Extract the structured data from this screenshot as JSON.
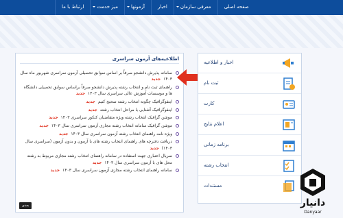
{
  "nav": {
    "items": [
      {
        "label": "صفحه اصلی",
        "dropdown": false
      },
      {
        "label": "معرفی سازمان",
        "dropdown": true
      },
      {
        "label": "اخبار",
        "dropdown": false
      },
      {
        "label": "آزمونها",
        "dropdown": true
      },
      {
        "label": "میز خدمت",
        "dropdown": true
      },
      {
        "label": "ارتباط با ما",
        "dropdown": false
      }
    ]
  },
  "news": {
    "title": "اطلاعیه‌های آزمون سراسری",
    "new_badge": "جدید",
    "more_label": "بعدی",
    "items": [
      {
        "text": "سامانه پذیرش دانشجو صرفاً بر اساس سوابق تحصیلی آزمون سراسری شهریور ماه سال ۱۴۰۳",
        "new": true
      },
      {
        "text": "راهنمای ثبت نام و انتخاب رشته پذیرش دانشجو صرفاً براساس سوابق تحصیلی دانشگاه ها و موسسات آموزش عالی سراسری سال ۱۴۰۳",
        "new": true
      },
      {
        "text": "اینفوگرافیک چگونه انتخاب رشته صحیح کنیم",
        "new": true
      },
      {
        "text": "اینفوگرافیک آشنایی با مراحل انتخاب رشته",
        "new": true
      },
      {
        "text": "موشن گرافیک انتخاب رشته ویژه متقاضیان کنکور سراسری ۱۴۰۳",
        "new": true
      },
      {
        "text": "موشن گرافیک سامانه انتخاب رشته مجازی آزمون سراسری سال ۱۴۰۳",
        "new": true
      },
      {
        "text": "ویژه نامه راهنمای انتخاب رشته آزمون سراسری سال ۱۴۰۳",
        "new": true
      },
      {
        "text": "دریافت دفترچه های راهنمای انتخاب رشته های با آزمون و بدون آزمون (سراسری سال ۱۴۰۳)",
        "new": true
      },
      {
        "text": "سریال اعتباری جهت استفاده در سامانه راهنمای انتخاب رشته مجازی مربوط به رشته محل های با آزمون سراسری سال ۱۴۰۳",
        "new": true
      },
      {
        "text": "سامانه راهنمای انتخاب رشته مجازی آزمون سراسری سال ۱۴۰۳",
        "new": true
      }
    ]
  },
  "sidebar": {
    "items": [
      {
        "label": "اخبار و اطلاعیه",
        "icon": "megaphone-icon"
      },
      {
        "label": "ثبت نام",
        "icon": "registration-form-icon"
      },
      {
        "label": "کارت",
        "icon": "id-card-icon"
      },
      {
        "label": "اعلام نتایج",
        "icon": "results-icon"
      },
      {
        "label": "برنامه زمانی",
        "icon": "calendar-icon"
      },
      {
        "label": "انتخاب رشته",
        "icon": "checklist-icon"
      },
      {
        "label": "مستندات",
        "icon": "documents-icon"
      }
    ]
  },
  "logo": {
    "text": "دانیار",
    "subtext": "Danyaar"
  },
  "colors": {
    "nav": "#0d4d9c",
    "accent_red": "#e0301e",
    "text_blue": "#1e3e72",
    "icon_orange": "#f2a623",
    "icon_blue": "#2f7fd1"
  }
}
